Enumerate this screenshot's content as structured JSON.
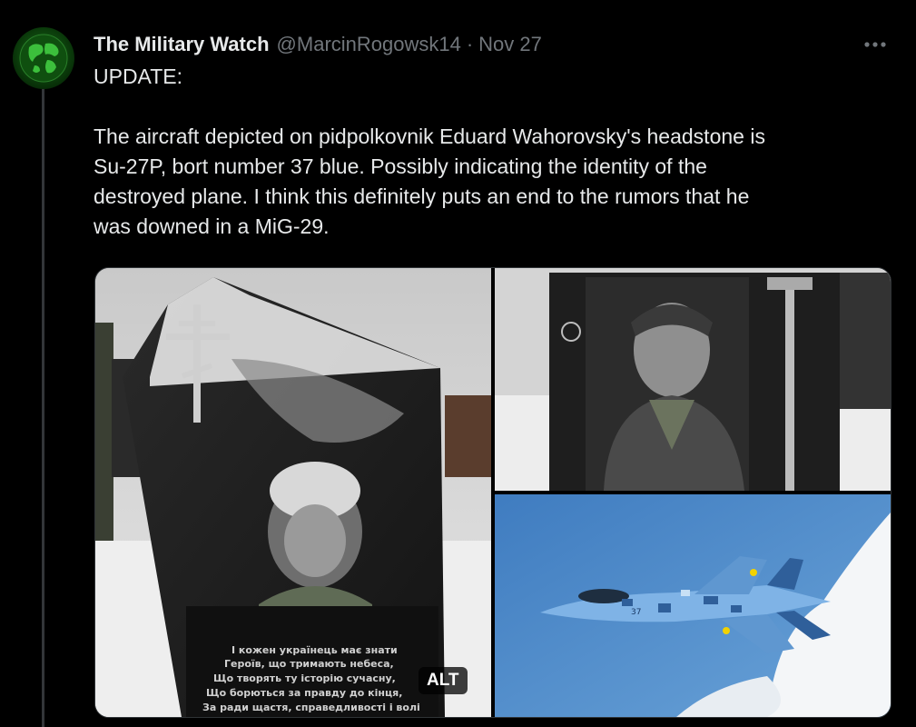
{
  "tweet": {
    "author_name": "The Military Watch",
    "author_handle": "@MarcinRogowsk14",
    "separator": "·",
    "date": "Nov 27",
    "more_icon": "more-horizontal-icon",
    "text_lines": [
      "UPDATE:",
      "The aircraft depicted on pidpolkovnik Eduard Wahorovsky's headstone is",
      "Su-27P, bort number 37 blue. Possibly indicating the identity of the",
      "destroyed plane. I think this definitely puts an end to the rumors that he",
      "was downed in a MiG-29."
    ]
  },
  "media": {
    "alt_label": "ALT",
    "headstone_inscription": [
      "І кожен українець має знати",
      "Героїв, що тримають небеса,",
      "Що творять ту історію сучасну,",
      "Що борються за правду до кінця,",
      "За ради щастя, справедливості і волі"
    ],
    "aircraft_number": "37",
    "colors": {
      "snow": "#e8e8e8",
      "granite": "#1a1a1a",
      "sky": "#4d86c2",
      "camo_light": "#7fb3e6",
      "camo_dark": "#2f5f9a"
    }
  }
}
